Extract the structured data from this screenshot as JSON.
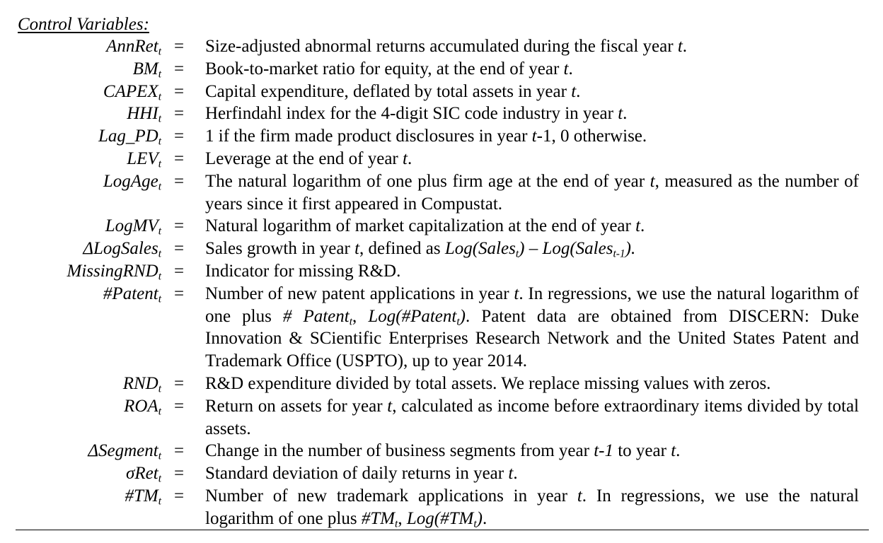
{
  "section_title": "Control Variables:",
  "equals_sign": "=",
  "subscripts": {
    "t": "t",
    "t_minus_1": "t-1"
  },
  "rows": [
    {
      "var": "AnnRet",
      "def_pre": "Size-adjusted abnormal returns accumulated during the fiscal year ",
      "def_italic": "t",
      "def_post": "."
    },
    {
      "var": "BM",
      "def_pre": "Book-to-market ratio for equity, at the end of year ",
      "def_italic": "t",
      "def_post": "."
    },
    {
      "var": "CAPEX",
      "def_pre": "Capital expenditure, deflated by total assets in year ",
      "def_italic": "t",
      "def_post": "."
    },
    {
      "var": "HHI",
      "def_pre": "Herfindahl index for the 4-digit SIC code industry in year ",
      "def_italic": "t",
      "def_post": "."
    },
    {
      "var": "Lag_PD",
      "def_pre": "1 if the firm made product disclosures in year ",
      "def_italic": "t",
      "def_post": "-1, 0 otherwise."
    },
    {
      "var": "LEV",
      "def_pre": "Leverage at the end of year ",
      "def_italic": "t",
      "def_post": "."
    },
    {
      "var": "LogAge",
      "def_pre": "The natural logarithm of one plus firm age at the end of year ",
      "def_italic": "t",
      "def_post": ", measured as the number of years since it first appeared in Compustat."
    },
    {
      "var": "LogMV",
      "def_pre": "Natural logarithm of market capitalization at the end of year ",
      "def_italic": "t",
      "def_post": "."
    },
    {
      "var": "ΔLogSales",
      "def_pre": "Sales growth in year ",
      "def_italic": "t",
      "def_mid": ", defined as ",
      "formula_a": "Log(Sales",
      "formula_b": ") – Log(Sales",
      "formula_c": ").",
      "def_post": ""
    },
    {
      "var": "MissingRND",
      "def_pre": "Indicator for missing R&D.",
      "def_italic": "",
      "def_post": ""
    },
    {
      "var": "#Patent",
      "def_pre": "Number of new patent applications in year ",
      "def_italic": "t",
      "def_post": ". In regressions, we use the natural logarithm of one plus ",
      "ital_a": "# Patent",
      "def_mid2": ", ",
      "ital_b": "Log(#Patent",
      "ital_b_close": ")",
      "def_post2": ". Patent data are obtained from DISCERN: Duke Innovation & SCientific Enterprises Research Network and the United States Patent and Trademark Office (USPTO), up to year 2014."
    },
    {
      "var": "RND",
      "def_pre": "R&D expenditure divided by total assets. We replace missing values with zeros.",
      "def_italic": "",
      "def_post": ""
    },
    {
      "var": "ROA",
      "def_pre": "Return on assets for year ",
      "def_italic": "t",
      "def_post": ", calculated as income before extraordinary items divided by total assets."
    },
    {
      "var": "ΔSegment",
      "def_pre": "Change in the number of business segments from year ",
      "def_italic": "t-1",
      "def_mid": " to year ",
      "def_italic2": "t",
      "def_post": "."
    },
    {
      "var": "σRet",
      "def_pre": "Standard deviation of daily returns in year ",
      "def_italic": "t",
      "def_post": "."
    },
    {
      "var": "#TM",
      "def_pre": "Number of new trademark applications in year ",
      "def_italic": "t",
      "def_post": ". In regressions, we use the natural logarithm of one plus ",
      "ital_a": "#TM",
      "def_mid2": ", ",
      "ital_b": "Log(#TM",
      "ital_b_close": ")",
      "def_post2": "."
    }
  ]
}
